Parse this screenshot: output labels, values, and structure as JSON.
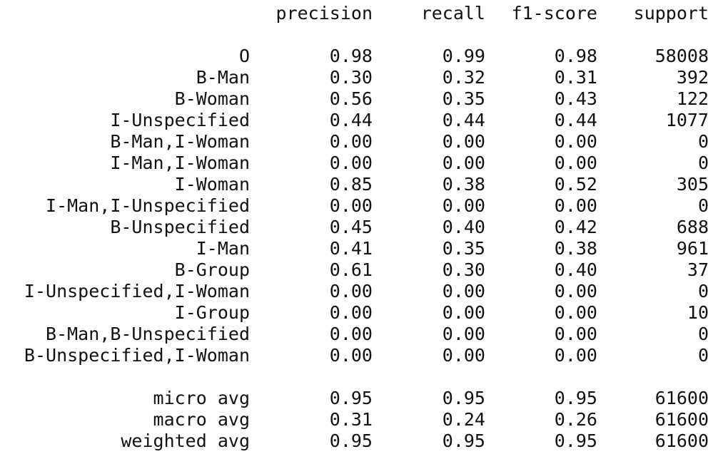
{
  "report": {
    "headers": {
      "precision": "precision",
      "recall": "recall",
      "f1": "f1-score",
      "support": "support"
    },
    "class_rows": [
      {
        "label": "O",
        "precision": "0.98",
        "recall": "0.99",
        "f1": "0.98",
        "support": "58008"
      },
      {
        "label": "B-Man",
        "precision": "0.30",
        "recall": "0.32",
        "f1": "0.31",
        "support": "392"
      },
      {
        "label": "B-Woman",
        "precision": "0.56",
        "recall": "0.35",
        "f1": "0.43",
        "support": "122"
      },
      {
        "label": "I-Unspecified",
        "precision": "0.44",
        "recall": "0.44",
        "f1": "0.44",
        "support": "1077"
      },
      {
        "label": "B-Man,I-Woman",
        "precision": "0.00",
        "recall": "0.00",
        "f1": "0.00",
        "support": "0"
      },
      {
        "label": "I-Man,I-Woman",
        "precision": "0.00",
        "recall": "0.00",
        "f1": "0.00",
        "support": "0"
      },
      {
        "label": "I-Woman",
        "precision": "0.85",
        "recall": "0.38",
        "f1": "0.52",
        "support": "305"
      },
      {
        "label": "I-Man,I-Unspecified",
        "precision": "0.00",
        "recall": "0.00",
        "f1": "0.00",
        "support": "0"
      },
      {
        "label": "B-Unspecified",
        "precision": "0.45",
        "recall": "0.40",
        "f1": "0.42",
        "support": "688"
      },
      {
        "label": "I-Man",
        "precision": "0.41",
        "recall": "0.35",
        "f1": "0.38",
        "support": "961"
      },
      {
        "label": "B-Group",
        "precision": "0.61",
        "recall": "0.30",
        "f1": "0.40",
        "support": "37"
      },
      {
        "label": "I-Unspecified,I-Woman",
        "precision": "0.00",
        "recall": "0.00",
        "f1": "0.00",
        "support": "0"
      },
      {
        "label": "I-Group",
        "precision": "0.00",
        "recall": "0.00",
        "f1": "0.00",
        "support": "10"
      },
      {
        "label": "B-Man,B-Unspecified",
        "precision": "0.00",
        "recall": "0.00",
        "f1": "0.00",
        "support": "0"
      },
      {
        "label": "B-Unspecified,I-Woman",
        "precision": "0.00",
        "recall": "0.00",
        "f1": "0.00",
        "support": "0"
      }
    ],
    "avg_rows": [
      {
        "label": "micro avg",
        "precision": "0.95",
        "recall": "0.95",
        "f1": "0.95",
        "support": "61600"
      },
      {
        "label": "macro avg",
        "precision": "0.31",
        "recall": "0.24",
        "f1": "0.26",
        "support": "61600"
      },
      {
        "label": "weighted avg",
        "precision": "0.95",
        "recall": "0.95",
        "f1": "0.95",
        "support": "61600"
      }
    ]
  }
}
